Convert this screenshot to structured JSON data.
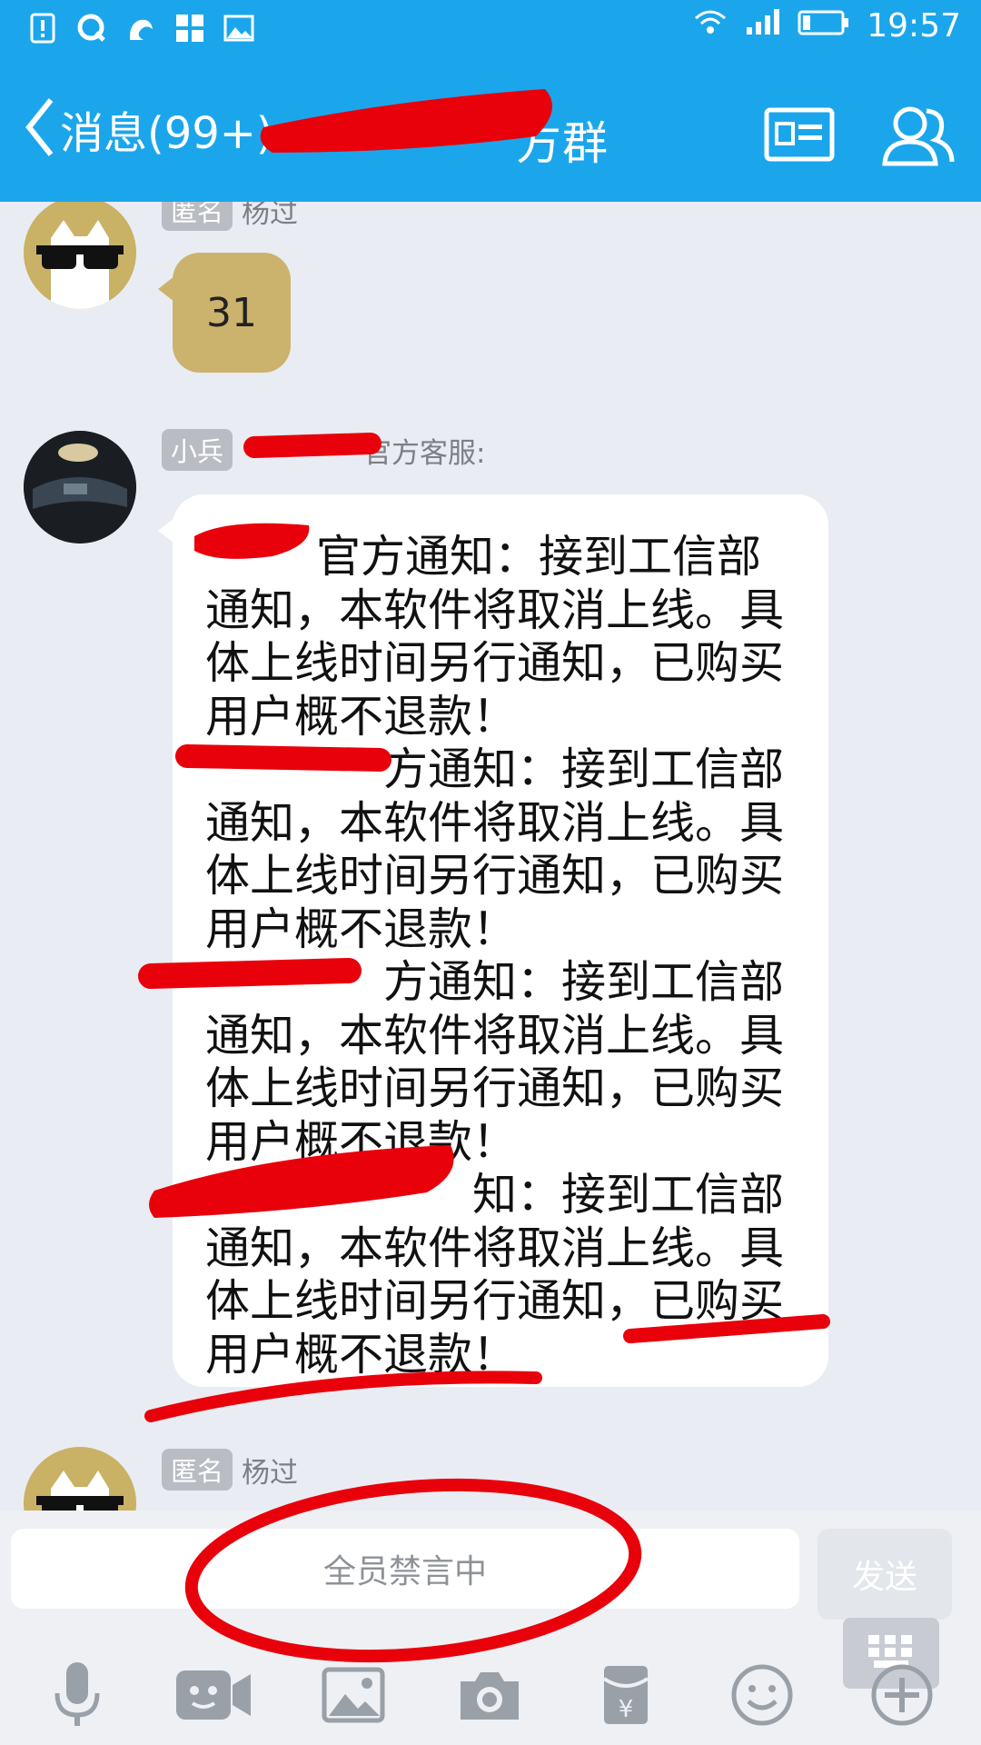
{
  "status_bar": {
    "time": "19:57",
    "icons": [
      "sim-alert-icon",
      "qq-icon",
      "uc-browser-icon",
      "apps-icon",
      "image-icon",
      "wifi-icon",
      "signal-icon",
      "battery-icon"
    ]
  },
  "header": {
    "back_label": "消息(99+)",
    "group_title_visible": "方群",
    "profile_card_icon": "profile-card-icon",
    "members_icon": "members-icon"
  },
  "messages": [
    {
      "tag": "匿名",
      "sender": "杨过",
      "text": "31"
    },
    {
      "tag": "小兵",
      "sender": "官方客服:",
      "lines": [
        "官方通知：接到工信部",
        "通知，本软件将取消上线。具",
        "体上线时间另行通知，已购买",
        "用户概不退款！",
        "方通知：接到工信部",
        "通知，本软件将取消上线。具",
        "体上线时间另行通知，已购买",
        "用户概不退款！",
        "方通知：接到工信部",
        "通知，本软件将取消上线。具",
        "体上线时间另行通知，已购买",
        "用户概不退款！",
        "知：接到工信部",
        "通知，本软件将取消上线。具",
        "体上线时间另行通知，已购买",
        "用户概不退款！"
      ]
    },
    {
      "tag": "匿名",
      "sender": "杨过"
    }
  ],
  "input": {
    "placeholder": "全员禁言中",
    "send_label": "发送"
  },
  "toolbar": [
    "microphone-icon",
    "video-call-icon",
    "picture-icon",
    "camera-icon",
    "red-packet-icon",
    "emoji-icon",
    "plus-icon"
  ],
  "colors": {
    "brand": "#1ba6ec",
    "gold_bubble": "#cbb36d",
    "annotation_red": "#e8000b"
  }
}
